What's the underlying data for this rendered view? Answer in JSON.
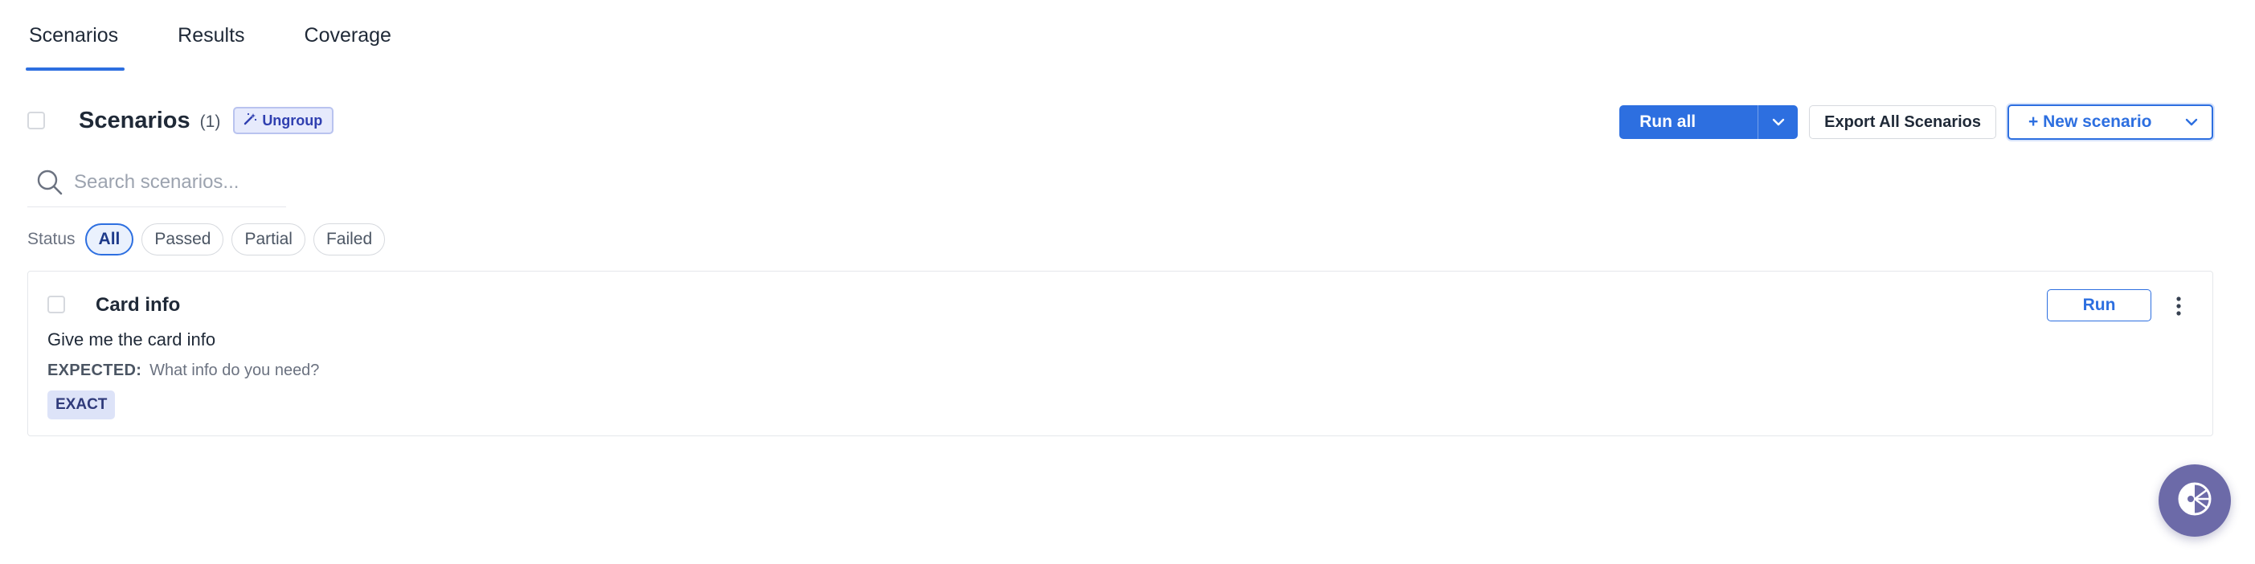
{
  "tabs": [
    {
      "label": "Scenarios",
      "active": true
    },
    {
      "label": "Results",
      "active": false
    },
    {
      "label": "Coverage",
      "active": false
    }
  ],
  "header": {
    "title": "Scenarios",
    "count": "(1)",
    "ungroup_label": "Ungroup"
  },
  "actions": {
    "run_all_label": "Run all",
    "export_label": "Export All Scenarios",
    "new_scenario_label": "+ New scenario"
  },
  "search": {
    "placeholder": "Search scenarios...",
    "value": ""
  },
  "filters": {
    "label": "Status",
    "options": [
      {
        "label": "All",
        "active": true
      },
      {
        "label": "Passed",
        "active": false
      },
      {
        "label": "Partial",
        "active": false
      },
      {
        "label": "Failed",
        "active": false
      }
    ]
  },
  "scenarios": [
    {
      "name": "Card info",
      "prompt": "Give me the card info",
      "expected_label": "EXPECTED:",
      "expected_value": "What info do you need?",
      "match_type": "EXACT",
      "run_label": "Run"
    }
  ],
  "colors": {
    "accent": "#2d6fe0",
    "ungroup_bg": "#e6eafc",
    "badge_bg": "#dde3f8",
    "fab_bg": "#6c6aa8"
  },
  "icons": {
    "ungroup": "magic-wand-icon",
    "search": "search-icon",
    "dropdown": "chevron-down-icon",
    "more": "kebab-menu-icon",
    "help": "help-widget-icon"
  }
}
